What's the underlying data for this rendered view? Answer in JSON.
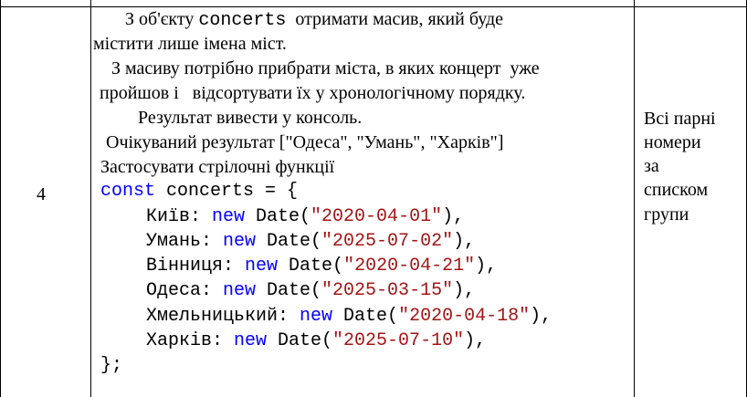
{
  "row": {
    "number": "4",
    "task": {
      "line1_pre": "З об'єкту ",
      "line1_code": "concerts",
      "line1_post": "  отримати масив, який буде",
      "line2": "містити лише імена міст.",
      "line3": "З масиву потрібно прибрати міста, в яких концерт  уже",
      "line4": "пройшов і   відсортувати їх у хронологічному порядку.",
      "line5": "Результат вивести у консоль.",
      "line6": "Очікуваний результат [\"Одеса\", \"Умань\", \"Харків\"]",
      "line7": "Застосувати стрілочні функції"
    },
    "code": {
      "decl_kw": "const",
      "decl_rest": " concerts = {",
      "new_kw": "new",
      "date_fn": " Date(",
      "entries": [
        {
          "key": "Київ: ",
          "date": "\"2020-04-01\""
        },
        {
          "key": "Умань: ",
          "date": "\"2025-07-02\""
        },
        {
          "key": "Вінниця: ",
          "date": "\"2020-04-21\""
        },
        {
          "key": "Одеса: ",
          "date": "\"2025-03-15\""
        },
        {
          "key": "Хмельницький: ",
          "date": "\"2020-04-18\""
        },
        {
          "key": "Харків: ",
          "date": "\"2025-07-10\""
        }
      ],
      "entry_end": "),",
      "close": "};"
    },
    "side_note": [
      "Всі парні",
      "номери",
      "за",
      "списком",
      "групи"
    ]
  }
}
